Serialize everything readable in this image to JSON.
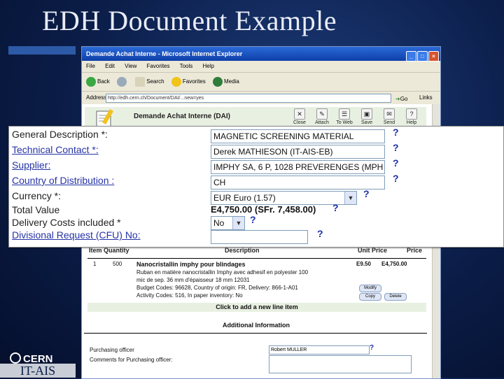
{
  "slide": {
    "title": "EDH Document Example",
    "logo_text": "CERN",
    "footer": "IT-AIS"
  },
  "window": {
    "title": "Demande Achat Interne - Microsoft Internet Explorer",
    "menu": [
      "File",
      "Edit",
      "View",
      "Favorites",
      "Tools",
      "Help"
    ],
    "toolbar": [
      "Back",
      "Search",
      "Favorites",
      "Media"
    ],
    "address_label": "Address",
    "address_value": "http://edh.cern.ch/Document/DAI/...new=yes",
    "go_label": "Go",
    "links_label": "Links"
  },
  "dai": {
    "title": "Demande Achat Interne (DAI)",
    "actions": [
      "Close",
      "Attach",
      "To Web",
      "Save",
      "Send",
      "Help"
    ]
  },
  "form": {
    "general_description_label": "General Description *:",
    "general_description_value": "MAGNETIC SCREENING MATERIAL",
    "technical_contact_label": "Technical Contact *:",
    "technical_contact_value": "Derek MATHIESON (IT-AIS-EB)",
    "supplier_label": "Supplier:",
    "supplier_value": "IMPHY SA, 6 P, 1028 PREVERENGES (MPH",
    "country_label": "Country of Distribution :",
    "country_value": "CH",
    "currency_label": "Currency *:",
    "currency_value": "EUR Euro (1.57)",
    "total_label": "Total Value",
    "total_value": "E4,750.00  (SFr. 7,458.00)",
    "delivery_label": "Delivery Costs included *",
    "delivery_value": "No",
    "divisional_label": "Divisional Request (CFU) No:",
    "help_glyph": "?"
  },
  "items": {
    "headers": {
      "item": "Item Quantity",
      "description": "Description",
      "unit_price": "Unit Price",
      "price": "Price"
    },
    "rows": [
      {
        "item": "1",
        "quantity": "500",
        "title": "Nanocristallin imphy pour blindages",
        "lines": [
          "Ruban en matière nanocristallin Imphy avec adhesif en polyester 100",
          "mic de sep. 36 mm d'épaisseur 18 mm 12031",
          "Budget Codes: 96628, Country of origin: FR, Delivery: 866-1-A01",
          "Activity Codes: 516, In paper inventory: No"
        ],
        "unit_price": "E9.50",
        "price": "E4,750.00",
        "buttons": [
          "Modify",
          "Delete",
          "Copy"
        ]
      }
    ],
    "add_line": "Click to add a new line item"
  },
  "additional": {
    "title": "Additional Information",
    "purchasing_label": "Purchasing officer",
    "purchasing_value": "Robert MULLER",
    "comments_label": "Comments for Purchasing officer:"
  },
  "colors": {
    "slide_bg": "#0b1d48",
    "link": "#2633a6",
    "help": "#1b2fa6",
    "ie_title": "#0e3fa8",
    "dai_header": "#e8f0e2"
  }
}
